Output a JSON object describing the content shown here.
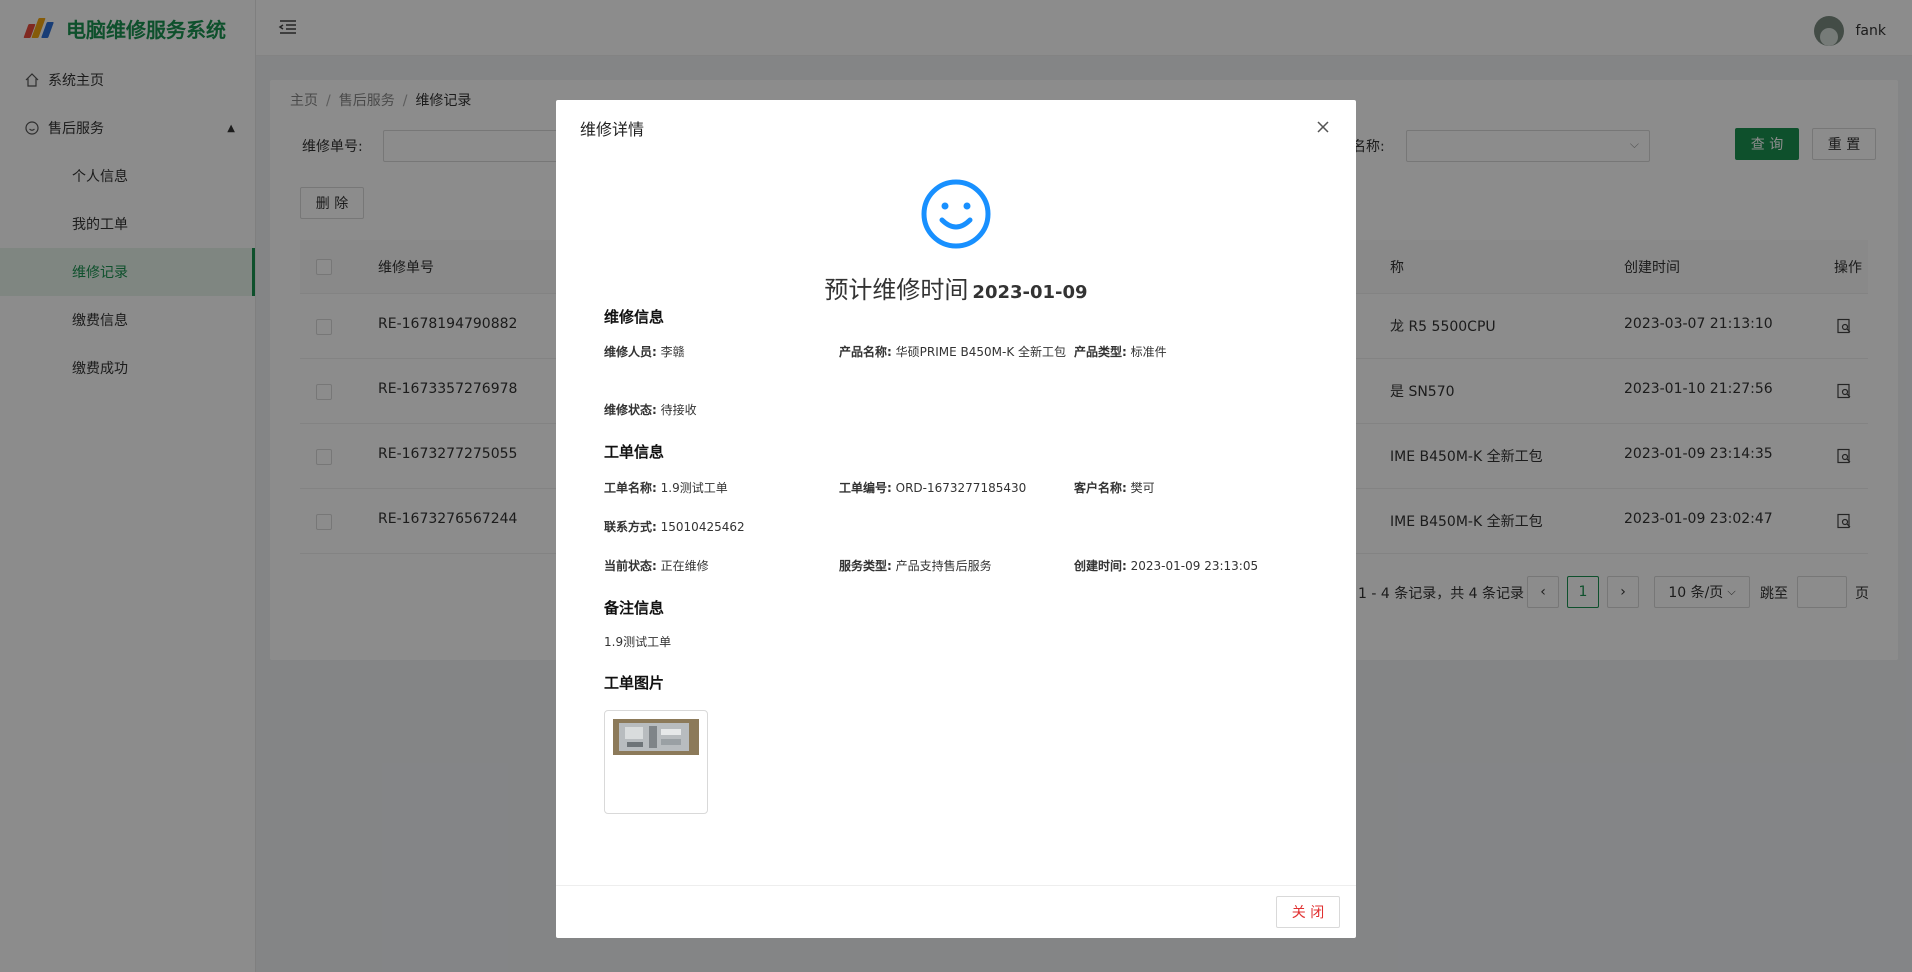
{
  "app": {
    "title": "电脑维修服务系统",
    "user_name": "fank"
  },
  "sidebar": {
    "home": "系统主页",
    "group": "售后服务",
    "items": [
      {
        "label": "个人信息"
      },
      {
        "label": "我的工单"
      },
      {
        "label": "维修记录"
      },
      {
        "label": "缴费信息"
      },
      {
        "label": "缴费成功"
      }
    ]
  },
  "breadcrumb": [
    "主页",
    "售后服务",
    "维修记录"
  ],
  "filters": {
    "repair_no_label": "维修单号:",
    "name_label": "名称:",
    "query": "查 询",
    "reset": "重 置",
    "delete": "删 除"
  },
  "table": {
    "headers": {
      "no": "维修单号",
      "product": "称",
      "created": "创建时间",
      "op": "操作"
    },
    "rows": [
      {
        "no": "RE-1678194790882",
        "product": "龙 R5 5500CPU",
        "created": "2023-03-07 21:13:10"
      },
      {
        "no": "RE-1673357276978",
        "product": "是 SN570",
        "created": "2023-01-10 21:27:56"
      },
      {
        "no": "RE-1673277275055",
        "product": "IME B450M-K 全新工包",
        "created": "2023-01-09 23:14:35"
      },
      {
        "no": "RE-1673276567244",
        "product": "IME B450M-K 全新工包",
        "created": "2023-01-09 23:02:47"
      }
    ]
  },
  "pager": {
    "summary": "1 - 4 条记录，共 4 条记录",
    "page": "1",
    "size": "10 条/页",
    "goto": "跳至",
    "page_unit": "页"
  },
  "modal": {
    "title": "维修详情",
    "estimate_label": "预计维修时间",
    "estimate_date": "2023-01-09",
    "sections": {
      "repair": "维修信息",
      "order": "工单信息",
      "note": "备注信息",
      "images": "工单图片"
    },
    "repair": {
      "staff_k": "维修人员:",
      "staff_v": "李赣",
      "product_k": "产品名称:",
      "product_v": "华硕PRIME B450M-K 全新工包",
      "ptype_k": "产品类型:",
      "ptype_v": "标准件",
      "status_k": "维修状态:",
      "status_v": "待接收"
    },
    "order": {
      "name_k": "工单名称:",
      "name_v": "1.9测试工单",
      "no_k": "工单编号:",
      "no_v": "ORD-1673277185430",
      "cust_k": "客户名称:",
      "cust_v": "樊可",
      "contact_k": "联系方式:",
      "contact_v": "15010425462",
      "state_k": "当前状态:",
      "state_v": "正在维修",
      "stype_k": "服务类型:",
      "stype_v": "产品支持售后服务",
      "ctime_k": "创建时间:",
      "ctime_v": "2023-01-09 23:13:05"
    },
    "note": "1.9测试工单",
    "close": "关 闭"
  },
  "colors": {
    "brand": "#1a9350",
    "close_text": "#e03030",
    "smiley": "#1890ff"
  }
}
